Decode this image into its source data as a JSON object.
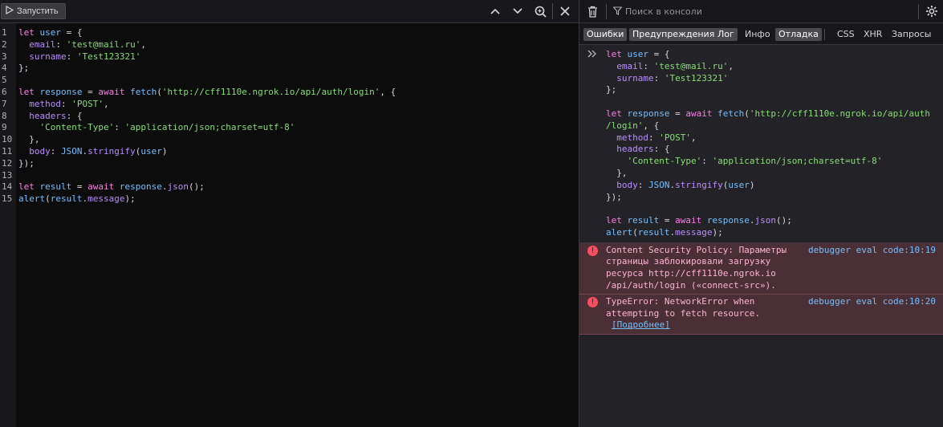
{
  "editor": {
    "run_label": "Запустить",
    "lines": [
      {
        "n": "1",
        "t": [
          [
            "kw",
            "let"
          ],
          [
            "pn",
            " "
          ],
          [
            "fn",
            "user"
          ],
          [
            "pn",
            " = {"
          ]
        ]
      },
      {
        "n": "2",
        "t": [
          [
            "pn",
            "  "
          ],
          [
            "prop",
            "email"
          ],
          [
            "pn",
            ": "
          ],
          [
            "str",
            "'test@mail.ru'"
          ],
          [
            "pn",
            ","
          ]
        ]
      },
      {
        "n": "3",
        "t": [
          [
            "pn",
            "  "
          ],
          [
            "prop",
            "surname"
          ],
          [
            "pn",
            ": "
          ],
          [
            "str",
            "'Test123321'"
          ]
        ]
      },
      {
        "n": "4",
        "t": [
          [
            "pn",
            "};"
          ]
        ]
      },
      {
        "n": "5",
        "t": []
      },
      {
        "n": "6",
        "t": [
          [
            "kw",
            "let"
          ],
          [
            "pn",
            " "
          ],
          [
            "fn",
            "response"
          ],
          [
            "pn",
            " = "
          ],
          [
            "kw",
            "await"
          ],
          [
            "pn",
            " "
          ],
          [
            "fn",
            "fetch"
          ],
          [
            "pn",
            "("
          ],
          [
            "str",
            "'http://cff1110e.ngrok.io/api/auth/login'"
          ],
          [
            "pn",
            ", {"
          ]
        ]
      },
      {
        "n": "7",
        "t": [
          [
            "pn",
            "  "
          ],
          [
            "prop",
            "method"
          ],
          [
            "pn",
            ": "
          ],
          [
            "str",
            "'POST'"
          ],
          [
            "pn",
            ","
          ]
        ]
      },
      {
        "n": "8",
        "t": [
          [
            "pn",
            "  "
          ],
          [
            "prop",
            "headers"
          ],
          [
            "pn",
            ": {"
          ]
        ]
      },
      {
        "n": "9",
        "t": [
          [
            "pn",
            "    "
          ],
          [
            "str",
            "'Content-Type'"
          ],
          [
            "pn",
            ": "
          ],
          [
            "str",
            "'application/json;charset=utf-8'"
          ]
        ]
      },
      {
        "n": "10",
        "t": [
          [
            "pn",
            "  },"
          ]
        ]
      },
      {
        "n": "11",
        "t": [
          [
            "pn",
            "  "
          ],
          [
            "prop",
            "body"
          ],
          [
            "pn",
            ": "
          ],
          [
            "fn",
            "JSON"
          ],
          [
            "pn",
            "."
          ],
          [
            "prop",
            "stringify"
          ],
          [
            "pn",
            "("
          ],
          [
            "fn",
            "user"
          ],
          [
            "pn",
            ")"
          ]
        ]
      },
      {
        "n": "12",
        "t": [
          [
            "pn",
            "});"
          ]
        ]
      },
      {
        "n": "13",
        "t": []
      },
      {
        "n": "14",
        "t": [
          [
            "kw",
            "let"
          ],
          [
            "pn",
            " "
          ],
          [
            "fn",
            "result"
          ],
          [
            "pn",
            " = "
          ],
          [
            "kw",
            "await"
          ],
          [
            "pn",
            " "
          ],
          [
            "fn",
            "response"
          ],
          [
            "pn",
            "."
          ],
          [
            "prop",
            "json"
          ],
          [
            "pn",
            "();"
          ]
        ]
      },
      {
        "n": "15",
        "t": [
          [
            "fn",
            "alert"
          ],
          [
            "pn",
            "("
          ],
          [
            "fn",
            "result"
          ],
          [
            "pn",
            "."
          ],
          [
            "prop",
            "message"
          ],
          [
            "pn",
            ");"
          ]
        ]
      }
    ]
  },
  "console": {
    "search_placeholder": "Поиск в консоли",
    "filters": [
      {
        "label": "Ошибки",
        "on": true
      },
      {
        "label": "Предупреждения",
        "on": true
      },
      {
        "label": "Лог",
        "on": true
      },
      {
        "label": "Инфо",
        "on": false
      },
      {
        "label": "Отладка",
        "on": true
      },
      {
        "label": "CSS",
        "on": false
      },
      {
        "label": "XHR",
        "on": false
      },
      {
        "label": "Запросы",
        "on": false
      }
    ],
    "echo_lines": [
      [
        [
          "kw",
          "let"
        ],
        [
          "pn",
          " "
        ],
        [
          "fn",
          "user"
        ],
        [
          "pn",
          " = {"
        ]
      ],
      [
        [
          "pn",
          "  "
        ],
        [
          "prop",
          "email"
        ],
        [
          "pn",
          ": "
        ],
        [
          "str",
          "'test@mail.ru'"
        ],
        [
          "pn",
          ","
        ]
      ],
      [
        [
          "pn",
          "  "
        ],
        [
          "prop",
          "surname"
        ],
        [
          "pn",
          ": "
        ],
        [
          "str",
          "'Test123321'"
        ]
      ],
      [
        [
          "pn",
          "};"
        ]
      ],
      [],
      [
        [
          "kw",
          "let"
        ],
        [
          "pn",
          " "
        ],
        [
          "fn",
          "response"
        ],
        [
          "pn",
          " = "
        ],
        [
          "kw",
          "await"
        ],
        [
          "pn",
          " "
        ],
        [
          "fn",
          "fetch"
        ],
        [
          "pn",
          "("
        ],
        [
          "str",
          "'http://cff1110e.ngrok.io/api/auth"
        ]
      ],
      [
        [
          "str",
          "/login'"
        ],
        [
          "pn",
          ", {"
        ]
      ],
      [
        [
          "pn",
          "  "
        ],
        [
          "prop",
          "method"
        ],
        [
          "pn",
          ": "
        ],
        [
          "str",
          "'POST'"
        ],
        [
          "pn",
          ","
        ]
      ],
      [
        [
          "pn",
          "  "
        ],
        [
          "prop",
          "headers"
        ],
        [
          "pn",
          ": {"
        ]
      ],
      [
        [
          "pn",
          "    "
        ],
        [
          "str",
          "'Content-Type'"
        ],
        [
          "pn",
          ": "
        ],
        [
          "str",
          "'application/json;charset=utf-8'"
        ]
      ],
      [
        [
          "pn",
          "  },"
        ]
      ],
      [
        [
          "pn",
          "  "
        ],
        [
          "prop",
          "body"
        ],
        [
          "pn",
          ": "
        ],
        [
          "fn",
          "JSON"
        ],
        [
          "pn",
          "."
        ],
        [
          "prop",
          "stringify"
        ],
        [
          "pn",
          "("
        ],
        [
          "fn",
          "user"
        ],
        [
          "pn",
          ")"
        ]
      ],
      [
        [
          "pn",
          "});"
        ]
      ],
      [],
      [
        [
          "kw",
          "let"
        ],
        [
          "pn",
          " "
        ],
        [
          "fn",
          "result"
        ],
        [
          "pn",
          " = "
        ],
        [
          "kw",
          "await"
        ],
        [
          "pn",
          " "
        ],
        [
          "fn",
          "response"
        ],
        [
          "pn",
          "."
        ],
        [
          "prop",
          "json"
        ],
        [
          "pn",
          "();"
        ]
      ],
      [
        [
          "fn",
          "alert"
        ],
        [
          "pn",
          "("
        ],
        [
          "fn",
          "result"
        ],
        [
          "pn",
          "."
        ],
        [
          "prop",
          "message"
        ],
        [
          "pn",
          ");"
        ]
      ]
    ],
    "errors": [
      {
        "lines": [
          "Content Security Policy: Параметры",
          "страницы заблокировали загрузку",
          "ресурса http://cff1110e.ngrok.io",
          "/api/auth/login («connect-src»)."
        ],
        "location": "debugger eval code:10:19"
      },
      {
        "lines": [
          "TypeError: NetworkError when",
          "attempting to fetch resource."
        ],
        "link": "[Подробнее]",
        "location": "debugger eval code:10:20"
      }
    ]
  },
  "icons": {
    "run": "play-icon",
    "up": "chevron-up-icon",
    "down": "chevron-down-icon",
    "zoom": "search-icon",
    "close": "close-icon",
    "trash": "trash-icon",
    "filter": "filter-icon",
    "settings": "gear-icon",
    "error": "error-icon",
    "prompt": "prompt-icon"
  }
}
